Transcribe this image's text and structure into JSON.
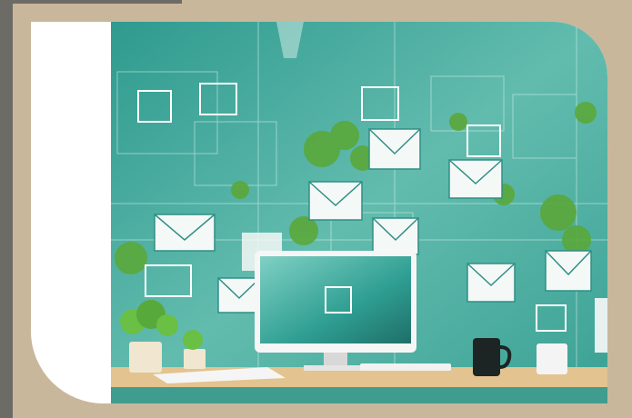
{
  "image": {
    "description_colors": {
      "background": "#c9b79b",
      "sidebar": "#6d6b66",
      "teal": "#3aa69b",
      "teal_light": "#8fd3c6",
      "leaf": "#5aa83a",
      "desk": "#e3c38f"
    },
    "icons": [
      "envelope-icon",
      "monitor-icon",
      "mug-icon",
      "plant-icon"
    ]
  }
}
